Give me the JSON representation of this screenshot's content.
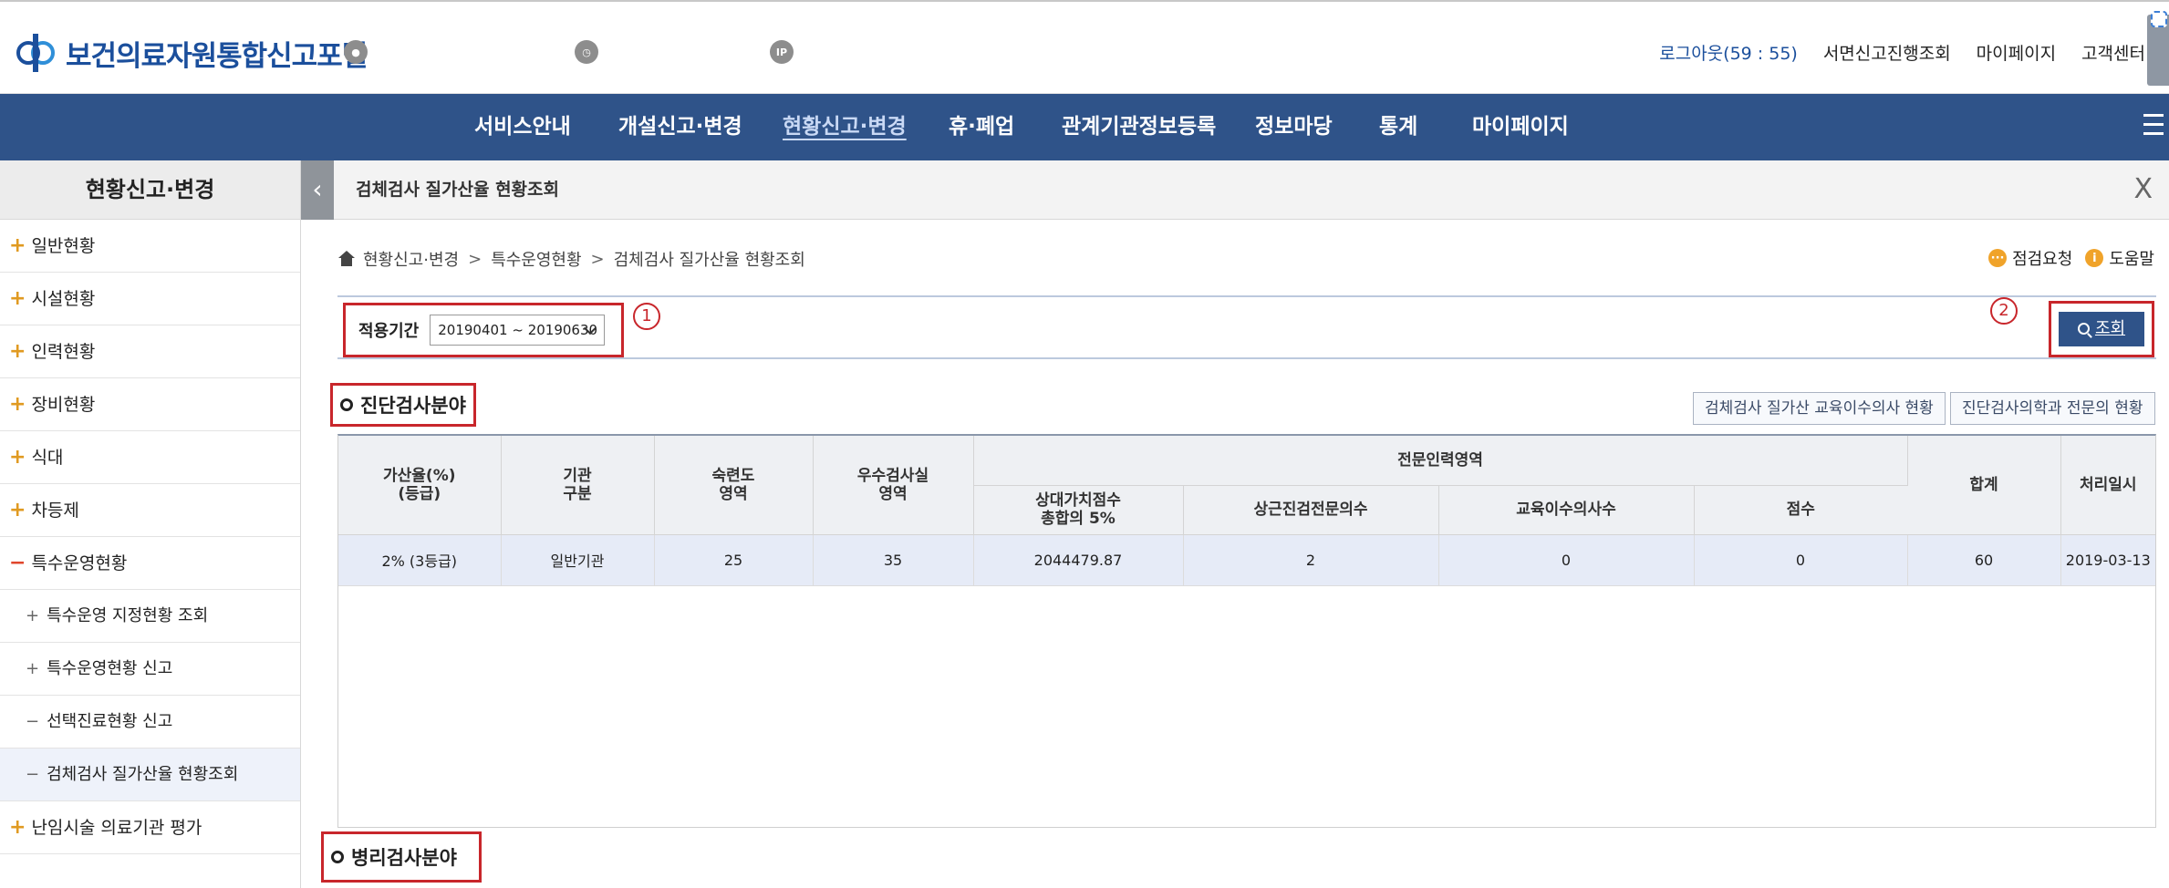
{
  "header": {
    "logo_text": "보건의료자원통합신고포털",
    "icon_ip_label": "IP",
    "links": {
      "logout": "로그아웃(59 : 55)",
      "paper_report": "서면신고진행조회",
      "mypage": "마이페이지",
      "support": "고객센터"
    }
  },
  "nav": {
    "items": [
      "서비스안내",
      "개설신고·변경",
      "현황신고·변경",
      "휴·폐업",
      "관계기관정보등록",
      "정보마당",
      "통계",
      "마이페이지"
    ],
    "active_index": 2
  },
  "sidebar": {
    "title": "현황신고·변경",
    "items": [
      "일반현황",
      "시설현황",
      "인력현황",
      "장비현황",
      "식대",
      "차등제",
      "특수운영현황"
    ],
    "sub_items": [
      "특수운영 지정현황 조회",
      "특수운영현황 신고",
      "선택진료현황 신고",
      "검체검사 질가산율 현황조회"
    ],
    "last_item": "난임시술 의료기관 평가"
  },
  "tab": {
    "title": "검체검사 질가산율 현황조회",
    "close": "X"
  },
  "breadcrumb": [
    "현황신고·변경",
    "특수운영현황",
    "검체검사 질가산율 현황조회"
  ],
  "help": {
    "inspect": "점검요청",
    "help": "도움말"
  },
  "filter": {
    "label": "적용기간",
    "value": "20190401 ~ 20190630",
    "marker1": "1",
    "marker2": "2",
    "search_label": "조회"
  },
  "section1": {
    "title": "진단검사분야",
    "btn_edu": "검체검사 질가산 교육이수의사 현황",
    "btn_specialist": "진단검사의학과 전문의 현황"
  },
  "table": {
    "headers": {
      "rate": "가산율(%)\n(등급)",
      "type": "기관\n구분",
      "skill": "숙련도\n영역",
      "lab": "우수검사실\n영역",
      "group": "전문인력영역",
      "relative": "상대가치점수\n총합의 5%",
      "fulltime": "상근진검전문의수",
      "edu": "교육이수의사수",
      "score": "점수",
      "total": "합계",
      "date": "처리일시"
    },
    "row": [
      "2% (3등급)",
      "일반기관",
      "25",
      "35",
      "2044479.87",
      "2",
      "0",
      "0",
      "60",
      "2019-03-13"
    ]
  },
  "section2": {
    "title": "병리검사분야"
  }
}
